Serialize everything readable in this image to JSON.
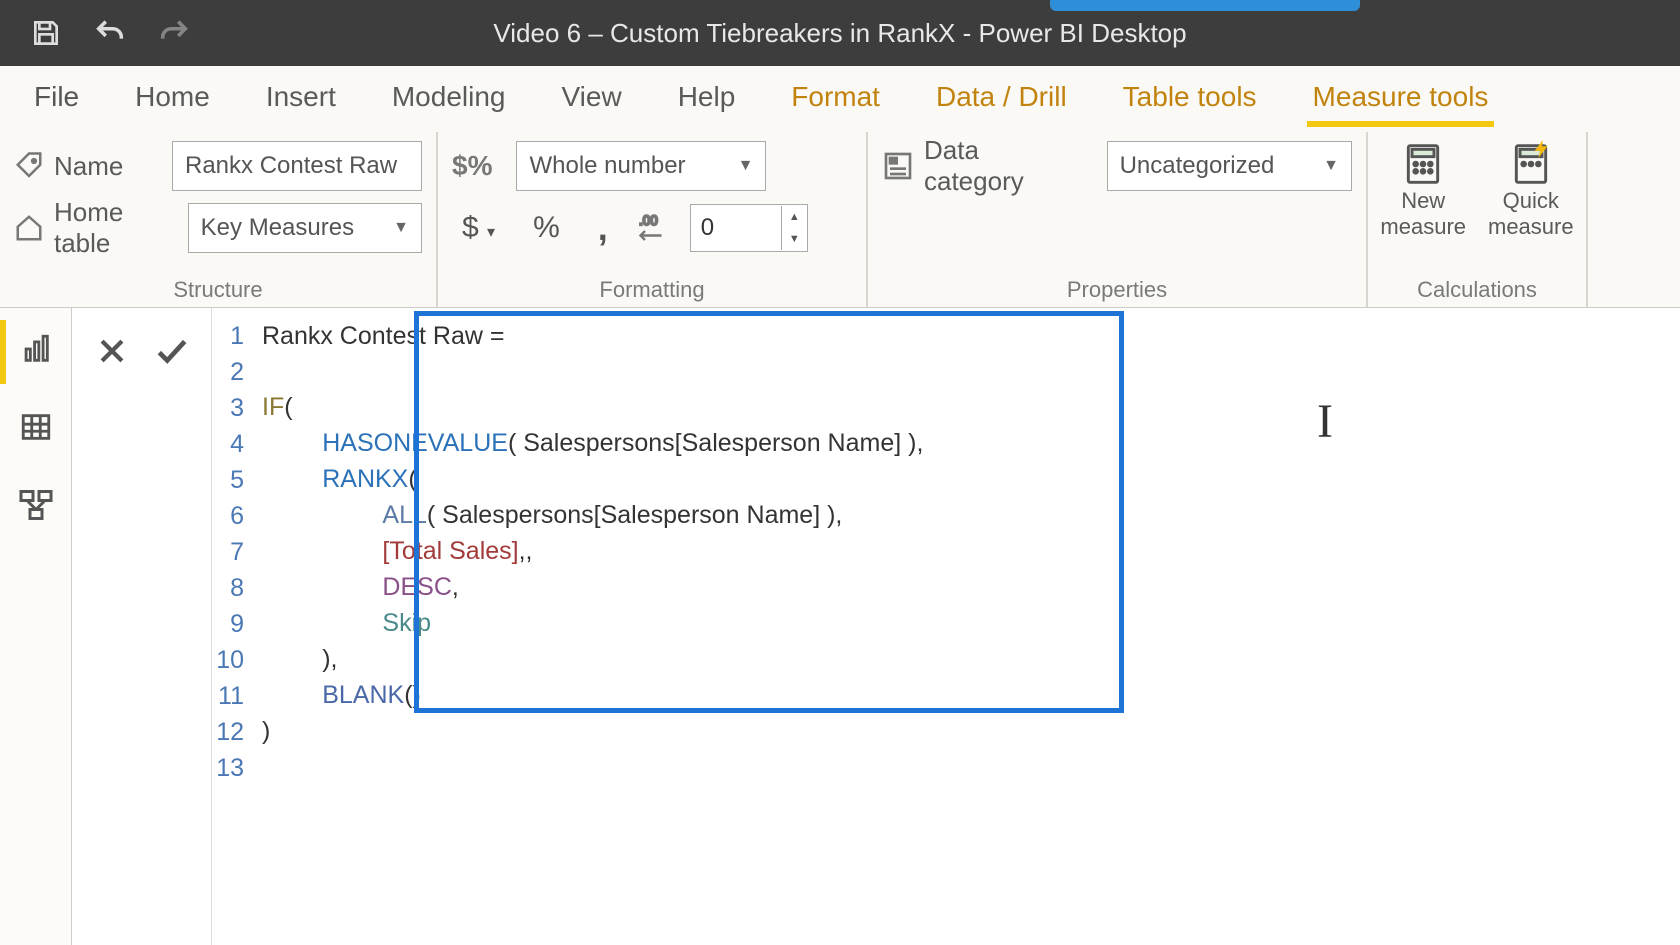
{
  "titlebar": {
    "title": "Video 6 – Custom Tiebreakers in RankX - Power BI Desktop"
  },
  "tabs": {
    "file": "File",
    "home": "Home",
    "insert": "Insert",
    "modeling": "Modeling",
    "view": "View",
    "help": "Help",
    "format": "Format",
    "data_drill": "Data / Drill",
    "table_tools": "Table tools",
    "measure_tools": "Measure tools"
  },
  "structure": {
    "name_label": "Name",
    "name_value": "Rankx Contest Raw",
    "home_table_label": "Home table",
    "home_table_value": "Key Measures",
    "group_label": "Structure"
  },
  "formatting": {
    "format_value": "Whole number",
    "decimals_value": "0",
    "group_label": "Formatting"
  },
  "properties": {
    "data_category_label": "Data category",
    "data_category_value": "Uncategorized",
    "group_label": "Properties"
  },
  "calculations": {
    "new_measure_top": "New",
    "new_measure_bot": "measure",
    "quick_measure_top": "Quick",
    "quick_measure_bot": "measure",
    "group_label": "Calculations"
  },
  "code": {
    "line_numbers": [
      "1",
      "2",
      "3",
      "4",
      "5",
      "6",
      "7",
      "8",
      "9",
      "10",
      "11",
      "12",
      "13"
    ],
    "l1_a": "Rankx Contest Raw ",
    "l1_b": "=",
    "l3_if": "IF",
    "l3_paren": "(",
    "l4_fn": "HASONEVALUE",
    "l4_rest": "( Salespersons[Salesperson Name] ),",
    "l5_fn": "RANKX",
    "l5_paren": "(",
    "l6_all": "ALL",
    "l6_rest": "( Salespersons[Salesperson Name] ),",
    "l7_meas": "[Total Sales]",
    "l7_rest": ",,",
    "l8_desc": "DESC",
    "l8_rest": ",",
    "l9_skip": "Skip",
    "l10": "),",
    "l11_blank": "BLANK",
    "l11_rest": "()",
    "l12": ")"
  }
}
